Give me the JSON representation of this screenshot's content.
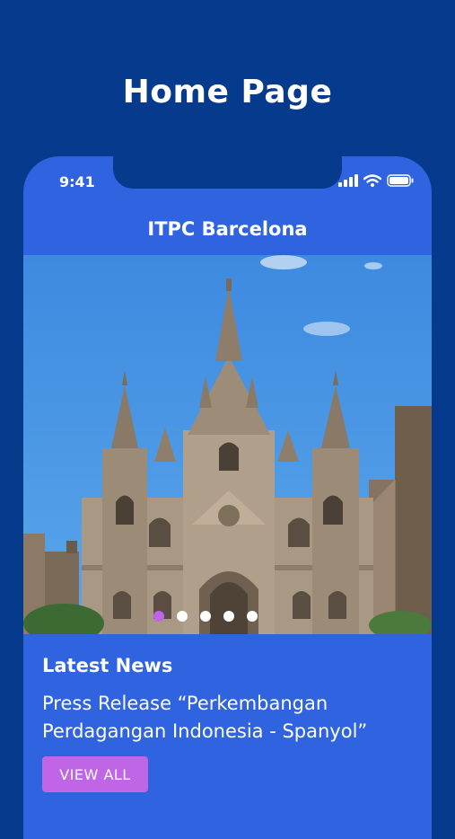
{
  "page": {
    "heading": "Home Page"
  },
  "status_bar": {
    "time": "9:41"
  },
  "app": {
    "title": "ITPC Barcelona"
  },
  "carousel": {
    "slide_count": 5,
    "active_index": 0,
    "image": "cathedral-photo"
  },
  "news": {
    "section_title": "Latest News",
    "headline": "Press Release “Perkembangan Perdagangan Indonesia - Spanyol”",
    "view_all_label": "VIEW ALL"
  },
  "colors": {
    "background": "#063a8c",
    "app_bar": "#2f63e0",
    "accent": "#bf65e6"
  }
}
